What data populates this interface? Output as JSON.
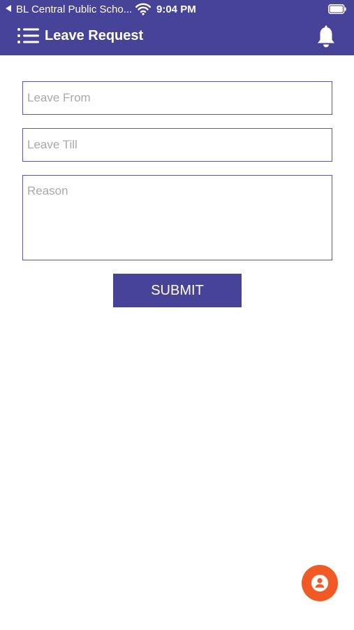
{
  "status_bar": {
    "carrier": "BL Central Public Scho...",
    "time": "9:04 PM",
    "icons": [
      "back-arrow-icon",
      "wifi-icon",
      "battery-icon"
    ]
  },
  "app_bar": {
    "title": "Leave Request",
    "menu_icon": "menu-list-icon",
    "notification_icon": "bell-icon"
  },
  "form": {
    "leave_from": {
      "value": "",
      "placeholder": "Leave From"
    },
    "leave_till": {
      "value": "",
      "placeholder": "Leave Till"
    },
    "reason": {
      "value": "",
      "placeholder": "Reason"
    },
    "submit_label": "SUBMIT"
  },
  "fab": {
    "icon": "user-profile-icon"
  },
  "colors": {
    "primary": "#474398",
    "field_border": "#5a57a8",
    "placeholder": "#a8a8a8",
    "fab": "#f15a24",
    "background": "#ffffff"
  }
}
